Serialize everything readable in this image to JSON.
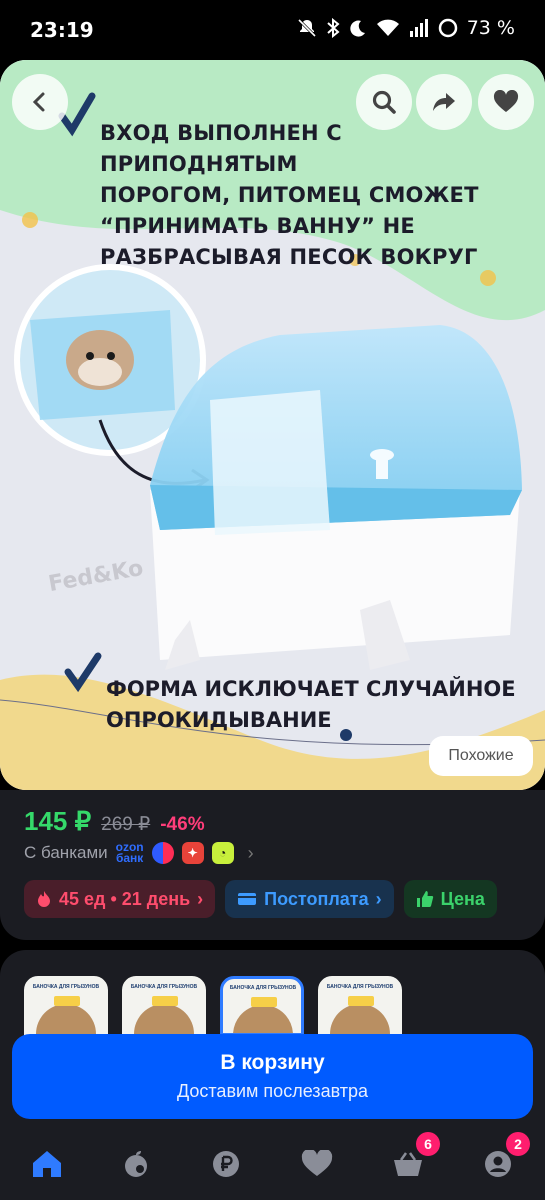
{
  "status_bar": {
    "time": "23:19",
    "battery_percent": "73 %",
    "icons": [
      "bell-off-icon",
      "bluetooth-icon",
      "moon-icon",
      "wifi-icon",
      "signal-icon",
      "battery-ring-icon"
    ]
  },
  "hero": {
    "caption_top_lines": [
      "ВХОД ВЫПОЛНЕН С ПРИПОДНЯТЫМ",
      "ПОРОГОМ, ПИТОМЕЦ СМОЖЕТ",
      "“ПРИНИМАТЬ ВАННУ” НЕ",
      "РАЗБРАСЫВАЯ ПЕСОК ВОКРУГ"
    ],
    "caption_bottom_lines": [
      "ФОРМА ИСКЛЮЧАЕТ СЛУЧАЙНОЕ",
      "ОПРОКИДЫВАНИЕ"
    ],
    "watermark": "Fed&Ko",
    "similar_label": "Похожие",
    "buttons": [
      "back-icon",
      "search-icon",
      "share-icon",
      "heart-icon"
    ]
  },
  "price": {
    "current": "145 ₽",
    "old": "269 ₽",
    "discount": "-46%",
    "banks_label": "С банками",
    "ozon_line1": "ozon",
    "ozon_line2": "банк"
  },
  "chips": [
    {
      "label": "45 ед • 21 день",
      "icon": "fire-icon"
    },
    {
      "label": "Постоплата",
      "icon": "card-icon"
    },
    {
      "label": "Цена",
      "icon": "thumbs-up-icon"
    }
  ],
  "thumb_text": "БАНОЧКА ДЛЯ ГРЫЗУНОВ",
  "cart": {
    "title": "В корзину",
    "subtitle": "Доставим послезавтра"
  },
  "bottom_nav": {
    "items": [
      "home-icon",
      "fresh-icon",
      "ruble-icon",
      "favorites-icon",
      "cart-icon",
      "profile-icon"
    ],
    "cart_badge": "6",
    "profile_badge": "2"
  },
  "colors": {
    "accent_blue": "#005bff",
    "price_green": "#35d96a",
    "discount_pink": "#ff3d7a",
    "badge_pink": "#ff1e6e"
  }
}
